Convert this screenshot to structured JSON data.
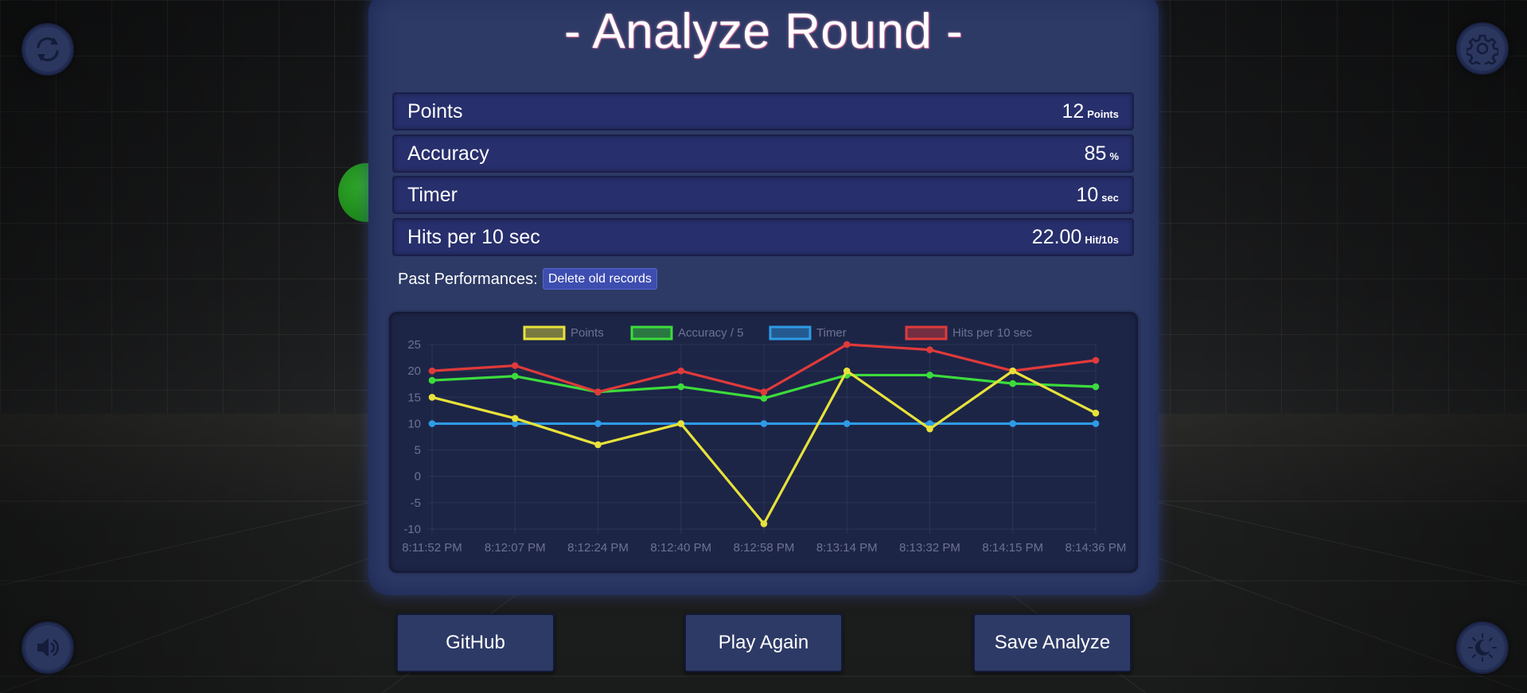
{
  "title": "- Analyze Round -",
  "stats": [
    {
      "label": "Points",
      "value": "12",
      "unit": "Points"
    },
    {
      "label": "Accuracy",
      "value": "85",
      "unit": "%"
    },
    {
      "label": "Timer",
      "value": "10",
      "unit": "sec"
    },
    {
      "label": "Hits per 10 sec",
      "value": "22.00",
      "unit": "Hit/10s"
    }
  ],
  "past_label": "Past Performances:",
  "delete_label": "Delete old records",
  "buttons": {
    "github": "GitHub",
    "play_again": "Play Again",
    "save_analyze": "Save Analyze"
  },
  "icons": {
    "restart": "refresh-icon",
    "settings": "gear-icon",
    "sound": "speaker-icon",
    "theme": "moon-icon"
  },
  "colors": {
    "panel": "#2d3a66",
    "accent": "#3d4db0"
  },
  "chart_data": {
    "type": "line",
    "x": [
      "8:11:52 PM",
      "8:12:07 PM",
      "8:12:24 PM",
      "8:12:40 PM",
      "8:12:58 PM",
      "8:13:14 PM",
      "8:13:32 PM",
      "8:14:15 PM",
      "8:14:36 PM"
    ],
    "ylim": [
      -10,
      25
    ],
    "yticks": [
      "25",
      "20",
      "15",
      "10",
      "5",
      "0",
      "-5",
      "-10"
    ],
    "grid": true,
    "legend_position": "top",
    "series": [
      {
        "name": "Points",
        "color": "#e8e23a",
        "values": [
          15,
          11,
          6,
          10,
          -9,
          20,
          9,
          20,
          12
        ]
      },
      {
        "name": "Accuracy / 5",
        "color": "#3cdc3c",
        "values": [
          18.2,
          19,
          16,
          17,
          14.8,
          19.2,
          19.2,
          17.6,
          17
        ]
      },
      {
        "name": "Timer",
        "color": "#2e9be6",
        "values": [
          10,
          10,
          10,
          10,
          10,
          10,
          10,
          10,
          10
        ]
      },
      {
        "name": "Hits per 10 sec",
        "color": "#e03a3a",
        "values": [
          20,
          21,
          16,
          20,
          16,
          25,
          24,
          20,
          22
        ]
      }
    ]
  }
}
